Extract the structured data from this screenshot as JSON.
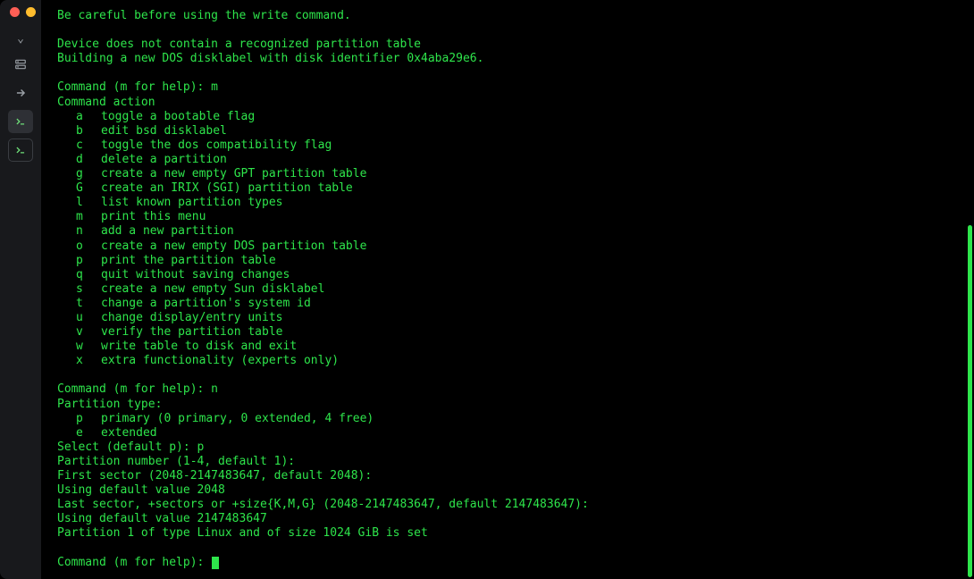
{
  "colors": {
    "fg": "#2ee54b",
    "bg": "#000000",
    "sidebar": "#18191c"
  },
  "intro": [
    "Be careful before using the write command.",
    "",
    "Device does not contain a recognized partition table",
    "Building a new DOS disklabel with disk identifier 0x4aba29e6.",
    ""
  ],
  "prompt_label": "Command (m for help): ",
  "first_input": "m",
  "command_action_header": "Command action",
  "actions": [
    {
      "k": "a",
      "t": "toggle a bootable flag"
    },
    {
      "k": "b",
      "t": "edit bsd disklabel"
    },
    {
      "k": "c",
      "t": "toggle the dos compatibility flag"
    },
    {
      "k": "d",
      "t": "delete a partition"
    },
    {
      "k": "g",
      "t": "create a new empty GPT partition table"
    },
    {
      "k": "G",
      "t": "create an IRIX (SGI) partition table"
    },
    {
      "k": "l",
      "t": "list known partition types"
    },
    {
      "k": "m",
      "t": "print this menu"
    },
    {
      "k": "n",
      "t": "add a new partition"
    },
    {
      "k": "o",
      "t": "create a new empty DOS partition table"
    },
    {
      "k": "p",
      "t": "print the partition table"
    },
    {
      "k": "q",
      "t": "quit without saving changes"
    },
    {
      "k": "s",
      "t": "create a new empty Sun disklabel"
    },
    {
      "k": "t",
      "t": "change a partition's system id"
    },
    {
      "k": "u",
      "t": "change display/entry units"
    },
    {
      "k": "v",
      "t": "verify the partition table"
    },
    {
      "k": "w",
      "t": "write table to disk and exit"
    },
    {
      "k": "x",
      "t": "extra functionality (experts only)"
    }
  ],
  "second_input": "n",
  "partition_type_header": "Partition type:",
  "ptypes": [
    {
      "k": "p",
      "t": "primary (0 primary, 0 extended, 4 free)"
    },
    {
      "k": "e",
      "t": "extended"
    }
  ],
  "select_label": "Select (default p): ",
  "select_input": "p",
  "tail": [
    "Partition number (1-4, default 1):",
    "First sector (2048-2147483647, default 2048):",
    "Using default value 2048",
    "Last sector, +sectors or +size{K,M,G} (2048-2147483647, default 2147483647):",
    "Using default value 2147483647",
    "Partition 1 of type Linux and of size 1024 GiB is set",
    ""
  ]
}
